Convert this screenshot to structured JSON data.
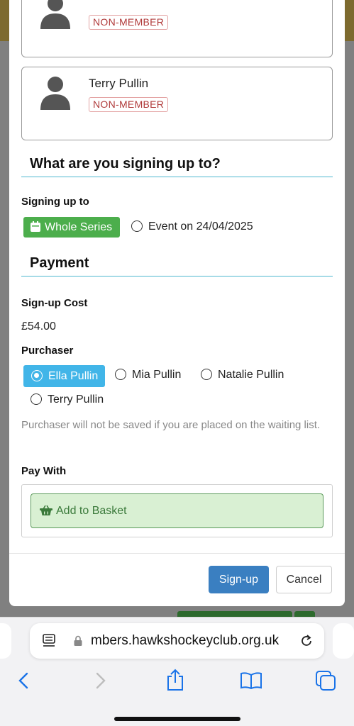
{
  "members": [
    {
      "name": "",
      "badge": "NON-MEMBER"
    },
    {
      "name": "Terry Pullin",
      "badge": "NON-MEMBER"
    }
  ],
  "signup_section": {
    "title": "What are you signing up to?",
    "label": "Signing up to",
    "options": [
      "Whole Series",
      "Event on 24/04/2025"
    ],
    "selected": "Whole Series"
  },
  "payment_section": {
    "title": "Payment",
    "cost_label": "Sign-up Cost",
    "cost_value": "£54.00",
    "purchaser_label": "Purchaser",
    "purchasers": [
      "Ella Pullin",
      "Mia Pullin",
      "Natalie Pullin",
      "Terry Pullin"
    ],
    "selected_purchaser": "Ella Pullin",
    "note": "Purchaser will not be saved if you are placed on the waiting list.",
    "pay_with_label": "Pay With",
    "basket_label": "Add to Basket"
  },
  "footer": {
    "signup_label": "Sign-up",
    "cancel_label": "Cancel"
  },
  "browser": {
    "url": "members.hawkshockeyclub.org.uk",
    "url_visible": "mbers.hawkshockeyclub.org.uk"
  },
  "colors": {
    "accent_green": "#4cae4c",
    "accent_blue": "#41b5e8",
    "primary": "#3a7fc1",
    "badge_red": "#b03a3a",
    "ios_blue": "#1a73e8"
  }
}
